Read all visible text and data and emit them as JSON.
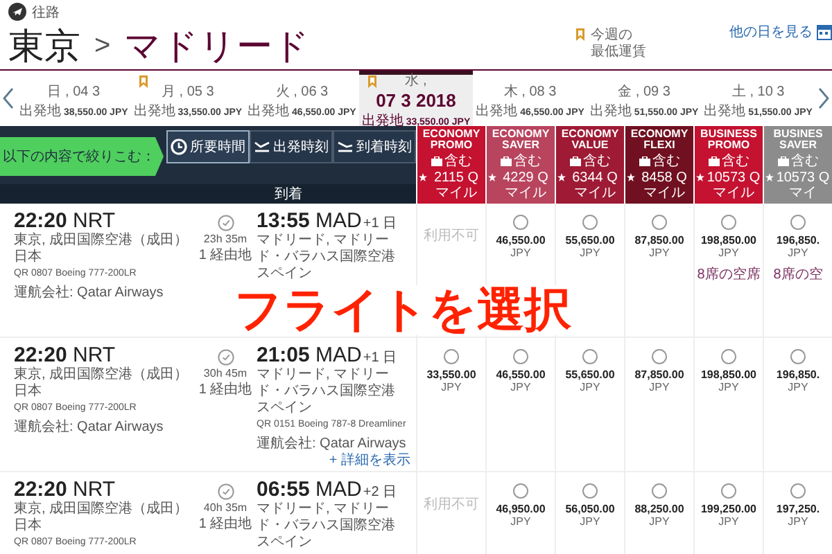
{
  "trip": {
    "direction": "往路"
  },
  "route": {
    "origin": "東京",
    "separator": ">",
    "destination": "マドリード"
  },
  "legend": {
    "lines": [
      "今週の",
      "最低運賃"
    ]
  },
  "other_dates_link": "他の日を見る",
  "dates": [
    {
      "day": "日 , 04 3",
      "label": "出発地",
      "price": "38,550.00 JPY",
      "lowest": false,
      "selected": false
    },
    {
      "day": "月 , 05 3",
      "label": "出発地",
      "price": "33,550.00 JPY",
      "lowest": true,
      "selected": false
    },
    {
      "day": "火 , 06 3",
      "label": "出発地",
      "price": "46,550.00 JPY",
      "lowest": false,
      "selected": false
    },
    {
      "day": "水 ,",
      "date": "07 3 2018",
      "label": "出発地",
      "price": "33,550.00 JPY",
      "lowest": true,
      "selected": true
    },
    {
      "day": "木 , 08 3",
      "label": "出発地",
      "price": "46,550.00 JPY",
      "lowest": false,
      "selected": false
    },
    {
      "day": "金 , 09 3",
      "label": "出発地",
      "price": "51,550.00 JPY",
      "lowest": false,
      "selected": false
    },
    {
      "day": "土 , 10 3",
      "label": "出発地",
      "price": "51,550.00 JPY",
      "lowest": false,
      "selected": false
    }
  ],
  "filter": {
    "label": "以下の内容で絞りこむ：",
    "column_label": "到着",
    "sorts": [
      {
        "kind": "duration",
        "label": "所要時間",
        "selected": true
      },
      {
        "kind": "departure",
        "label": "出発時刻",
        "selected": false
      },
      {
        "kind": "arrival",
        "label": "到着時刻",
        "selected": false
      }
    ]
  },
  "fare_classes": [
    {
      "name": "ECONOMY PROMO",
      "baggage": "含む",
      "miles": "2115 Qマイル",
      "color": "#c41230"
    },
    {
      "name": "ECONOMY SAVER",
      "baggage": "含む",
      "miles": "4229 Qマイル",
      "color": "#b8445e"
    },
    {
      "name": "ECONOMY VALUE",
      "baggage": "含む",
      "miles": "6344 Qマイル",
      "color": "#9e1a35"
    },
    {
      "name": "ECONOMY FLEXI",
      "baggage": "含む",
      "miles": "8458 Qマイル",
      "color": "#701020"
    },
    {
      "name": "BUSINESS PROMO",
      "baggage": "含む",
      "miles": "10573 Qマイル",
      "color": "#c41230"
    },
    {
      "name": "BUSINES SAVER",
      "baggage": "含む",
      "miles": "10573 Qマイ",
      "color": "#8c8c8c"
    }
  ],
  "flights": [
    {
      "depart": {
        "time": "22:20",
        "airport": "NRT",
        "city": "東京, 成田国際空港（成田）",
        "country": "日本"
      },
      "flight": "QR 0807 Boeing 777-200LR",
      "operator": "運航会社: Qatar Airways",
      "duration": "23h 35m",
      "stops": "1 経由地",
      "arrive": {
        "time": "13:55",
        "airport": "MAD",
        "day_offset": "+1 日",
        "city": "マドリード, マドリード・バラハス国際空港",
        "country": "スペイン"
      },
      "fares": [
        {
          "kind": "unavailable",
          "label": "利用不可"
        },
        {
          "kind": "price",
          "price": "46,550.00",
          "currency": "JPY",
          "selected": false
        },
        {
          "kind": "price",
          "price": "55,650.00",
          "currency": "JPY",
          "selected": false
        },
        {
          "kind": "price",
          "price": "87,850.00",
          "currency": "JPY",
          "selected": false
        },
        {
          "kind": "price",
          "price": "198,850.00",
          "currency": "JPY",
          "seats": "8席の空席",
          "selected": false
        },
        {
          "kind": "price",
          "price": "196,850.",
          "currency": "JPY",
          "seats": "8席の空",
          "selected": false
        }
      ]
    },
    {
      "depart": {
        "time": "22:20",
        "airport": "NRT",
        "city": "東京, 成田国際空港（成田）",
        "country": "日本"
      },
      "flight": "QR 0807 Boeing 777-200LR",
      "operator": "運航会社: Qatar Airways",
      "duration": "30h 45m",
      "stops": "1 経由地",
      "arrive": {
        "time": "21:05",
        "airport": "MAD",
        "day_offset": "+1 日",
        "city": "マドリード, マドリード・バラハス国際空港",
        "country": "スペイン",
        "flight": "QR 0151 Boeing 787-8 Dreamliner",
        "operator": "運航会社: Qatar Airways"
      },
      "details_link": "+ 詳細を表示",
      "fares": [
        {
          "kind": "price",
          "price": "33,550.00",
          "currency": "JPY",
          "selected": false
        },
        {
          "kind": "price",
          "price": "46,550.00",
          "currency": "JPY",
          "selected": false
        },
        {
          "kind": "price",
          "price": "55,650.00",
          "currency": "JPY",
          "selected": false
        },
        {
          "kind": "price",
          "price": "87,850.00",
          "currency": "JPY",
          "selected": false
        },
        {
          "kind": "price",
          "price": "198,850.00",
          "currency": "JPY",
          "selected": false
        },
        {
          "kind": "price",
          "price": "196,850.",
          "currency": "JPY",
          "selected": false
        }
      ]
    },
    {
      "depart": {
        "time": "22:20",
        "airport": "NRT",
        "city": "東京, 成田国際空港（成田）",
        "country": "日本"
      },
      "flight": "QR 0807 Boeing 777-200LR",
      "duration": "40h 35m",
      "stops": "1 経由地",
      "arrive": {
        "time": "06:55",
        "airport": "MAD",
        "day_offset": "+2 日",
        "city": "マドリード, マドリード・バラハス国際空港",
        "country": "スペイン"
      },
      "fares": [
        {
          "kind": "unavailable",
          "label": "利用不可"
        },
        {
          "kind": "price",
          "price": "46,950.00",
          "currency": "JPY",
          "selected": false
        },
        {
          "kind": "price",
          "price": "56,050.00",
          "currency": "JPY",
          "selected": false
        },
        {
          "kind": "price",
          "price": "88,250.00",
          "currency": "JPY",
          "selected": false
        },
        {
          "kind": "price",
          "price": "199,250.00",
          "currency": "JPY",
          "selected": false
        },
        {
          "kind": "price",
          "price": "197,250.",
          "currency": "JPY",
          "selected": false
        }
      ]
    }
  ],
  "caption": "フライトを選択"
}
